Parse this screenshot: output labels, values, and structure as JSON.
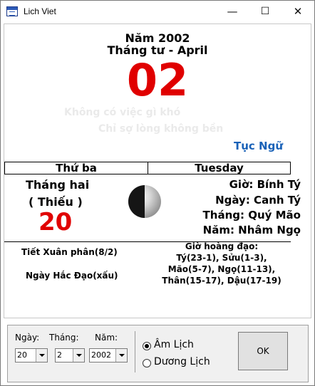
{
  "window": {
    "title": "Lich Viet",
    "minimize": "—",
    "maximize": "☐",
    "close": "✕"
  },
  "calendar": {
    "year_line": "Năm 2002",
    "month_line": "Tháng tư - April",
    "day_number": "02",
    "proverb_line1": "Không có việc gì khó",
    "proverb_line2": "Chỉ sợ lòng không bền",
    "proverb_label": "Tục Ngữ",
    "weekday_vn": "Thứ ba",
    "weekday_en": "Tuesday",
    "lunar_month": "Tháng hai",
    "lunar_month_size": "( Thiếu )",
    "lunar_day": "20",
    "hour_canchi": "Giờ: Bính Tý",
    "day_canchi": "Ngày: Canh Tý",
    "month_canchi": "Tháng: Quý Mão",
    "year_canchi": "Năm: Nhâm Ngọ",
    "solar_term": "Tiết Xuân phân(8/2)",
    "day_quality": "Ngày Hắc Đạo(xấu)",
    "auspicious_title": "Giờ hoàng đạo:",
    "auspicious_lines": [
      "Tý(23-1), Sửu(1-3),",
      "Mão(5-7), Ngọ(11-13),",
      "Thân(15-17), Dậu(17-19)"
    ]
  },
  "controls": {
    "day_label": "Ngày:",
    "month_label": "Tháng:",
    "year_label": "Năm:",
    "day_value": "20",
    "month_value": "2",
    "year_value": "2002",
    "radio_lunar": "Âm Lịch",
    "radio_solar": "Dương Lịch",
    "selected_mode": "lunar",
    "ok_label": "OK"
  },
  "colors": {
    "accent_red": "#e00000",
    "proverb_blue": "#1a62b8"
  }
}
